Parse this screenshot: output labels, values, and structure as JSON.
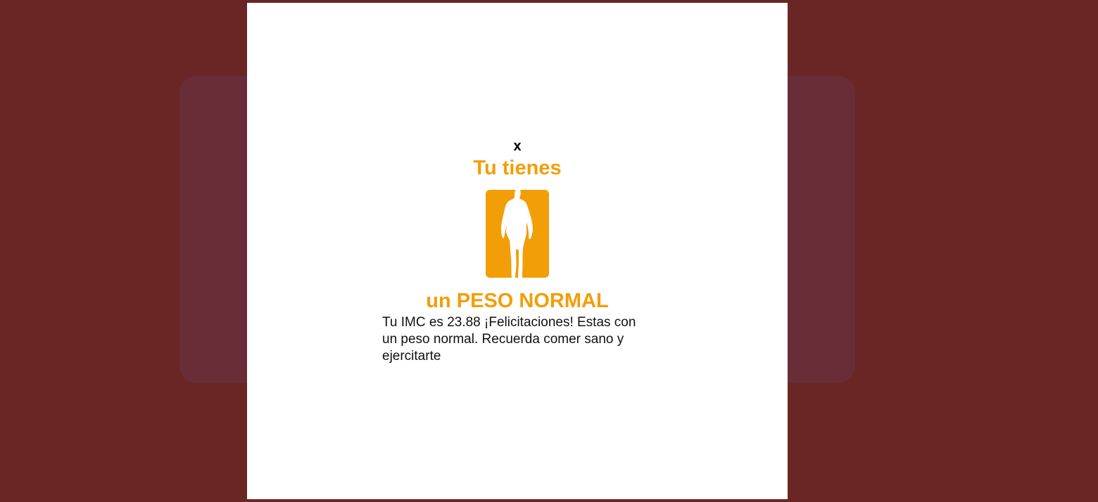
{
  "modal": {
    "close_label": "x",
    "title_top": "Tu tienes",
    "image_icon": "person-silhouette-icon",
    "title_bottom": "un PESO NORMAL",
    "message": "Tu IMC es 23.88 ¡Felicitaciones! Estas con un peso normal. Recuerda comer sano y ejercitarte"
  },
  "colors": {
    "page_background": "#692624",
    "backdrop_card": "#692d38",
    "modal_background": "#ffffff",
    "accent": "#f29e06",
    "text": "#111111"
  }
}
